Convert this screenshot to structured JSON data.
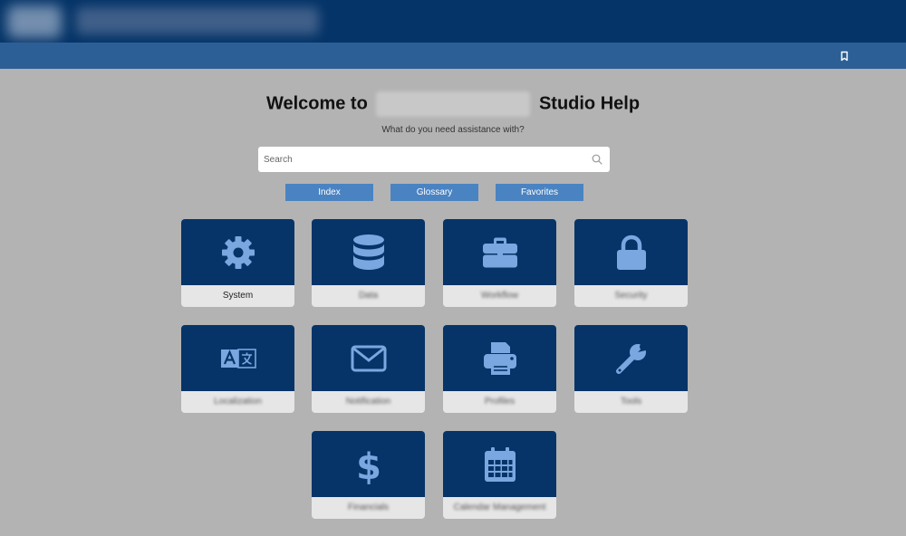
{
  "header": {
    "logo_icon": "logo",
    "bookmark_icon": "bookmark-icon"
  },
  "heading": {
    "prefix": "Welcome to",
    "suffix": "Studio Help"
  },
  "subtitle": "What do you need assistance with?",
  "search": {
    "placeholder": "Search",
    "icon": "search-icon"
  },
  "pills": [
    {
      "label": "Index"
    },
    {
      "label": "Glossary"
    },
    {
      "label": "Favorites"
    }
  ],
  "cards": [
    {
      "label": "System",
      "icon": "gear-icon"
    },
    {
      "label": "Data",
      "icon": "database-icon"
    },
    {
      "label": "Workflow",
      "icon": "briefcase-icon"
    },
    {
      "label": "Security",
      "icon": "lock-icon"
    },
    {
      "label": "Localization",
      "icon": "translate-icon"
    },
    {
      "label": "Notification",
      "icon": "envelope-icon"
    },
    {
      "label": "Profiles",
      "icon": "printer-icon"
    },
    {
      "label": "Tools",
      "icon": "wrench-icon"
    },
    {
      "label": "Financials",
      "icon": "dollar-icon"
    },
    {
      "label": "Calendar Management",
      "icon": "calendar-icon"
    }
  ],
  "colors": {
    "header": "#053468",
    "subheader": "#2c5f96",
    "card_top": "#063468",
    "icon": "#7aa7e0",
    "pill": "#4a83c2",
    "background": "#b3b3b3"
  }
}
